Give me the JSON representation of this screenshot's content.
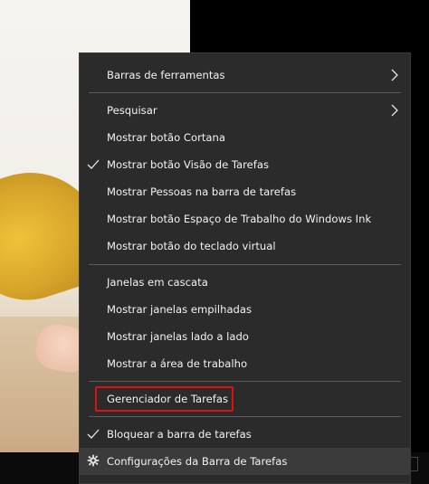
{
  "menu": {
    "items": [
      {
        "label": "Barras de ferramentas",
        "submenu": true,
        "checked": false
      },
      {
        "label": "Pesquisar",
        "submenu": true,
        "checked": false
      },
      {
        "label": "Mostrar botão Cortana",
        "submenu": false,
        "checked": false
      },
      {
        "label": "Mostrar botão Visão de Tarefas",
        "submenu": false,
        "checked": true
      },
      {
        "label": "Mostrar Pessoas na barra de tarefas",
        "submenu": false,
        "checked": false
      },
      {
        "label": "Mostrar botão Espaço de Trabalho do Windows Ink",
        "submenu": false,
        "checked": false
      },
      {
        "label": "Mostrar botão do teclado virtual",
        "submenu": false,
        "checked": false
      },
      {
        "label": "Janelas em cascata",
        "submenu": false,
        "checked": false
      },
      {
        "label": "Mostrar janelas empilhadas",
        "submenu": false,
        "checked": false
      },
      {
        "label": "Mostrar janelas lado a lado",
        "submenu": false,
        "checked": false
      },
      {
        "label": "Mostrar a área de trabalho",
        "submenu": false,
        "checked": false
      },
      {
        "label": "Gerenciador de Tarefas",
        "submenu": false,
        "checked": false,
        "highlighted": true
      },
      {
        "label": "Bloquear a barra de tarefas",
        "submenu": false,
        "checked": true
      },
      {
        "label": "Configurações da Barra de Tarefas",
        "submenu": false,
        "checked": false,
        "icon": "gear-icon",
        "hovered": true
      }
    ]
  },
  "colors": {
    "menu_bg": "#2b2b2b",
    "text": "#f2f2f2",
    "separator": "#5a5a5a",
    "highlight_border": "#e01010",
    "hover_bg": "#3b3b3b"
  }
}
